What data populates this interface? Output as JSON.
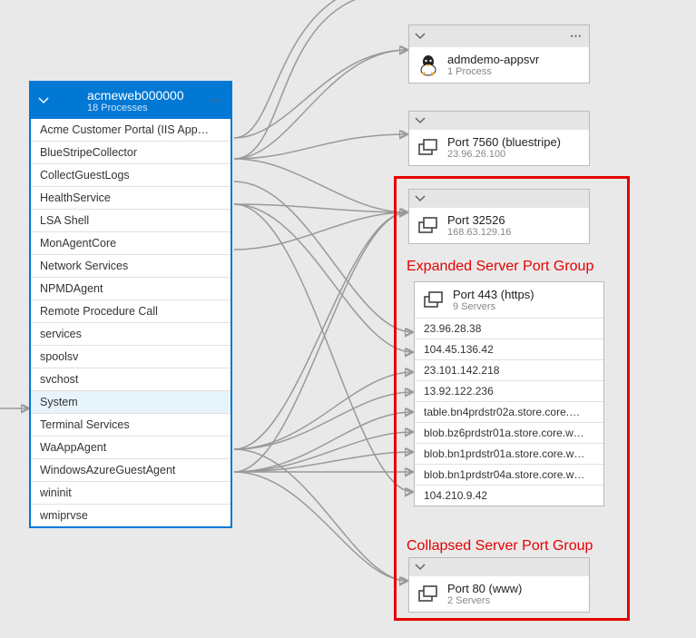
{
  "main_node": {
    "title": "acmeweb000000",
    "subtitle": "18 Processes",
    "processes": [
      "Acme Customer Portal (IIS App…",
      "BlueStripeCollector",
      "CollectGuestLogs",
      "HealthService",
      "LSA Shell",
      "MonAgentCore",
      "Network Services",
      "NPMDAgent",
      "Remote Procedure Call",
      "services",
      "spoolsv",
      "svchost",
      "System",
      "Terminal Services",
      "WaAppAgent",
      "WindowsAzureGuestAgent",
      "wininit",
      "wmiprvse"
    ],
    "selected_index": 12
  },
  "node_appsvr": {
    "title": "admdemo-appsvr",
    "subtitle": "1 Process"
  },
  "node_port7560": {
    "title": "Port 7560 (bluestripe)",
    "subtitle": "23.96.26.100"
  },
  "node_port32526": {
    "title": "Port 32526",
    "subtitle": "168.63.129.16"
  },
  "node_port443": {
    "title": "Port 443 (https)",
    "subtitle": "9 Servers",
    "servers": [
      "23.96.28.38",
      "104.45.136.42",
      "23.101.142.218",
      "13.92.122.236",
      "table.bn4prdstr02a.store.core.…",
      "blob.bz6prdstr01a.store.core.w…",
      "blob.bn1prdstr01a.store.core.w…",
      "blob.bn1prdstr04a.store.core.w…",
      "104.210.9.42"
    ]
  },
  "node_port80": {
    "title": "Port 80 (www)",
    "subtitle": "2 Servers"
  },
  "annotations": {
    "expanded": "Expanded Server Port Group",
    "collapsed": "Collapsed Server Port Group"
  }
}
